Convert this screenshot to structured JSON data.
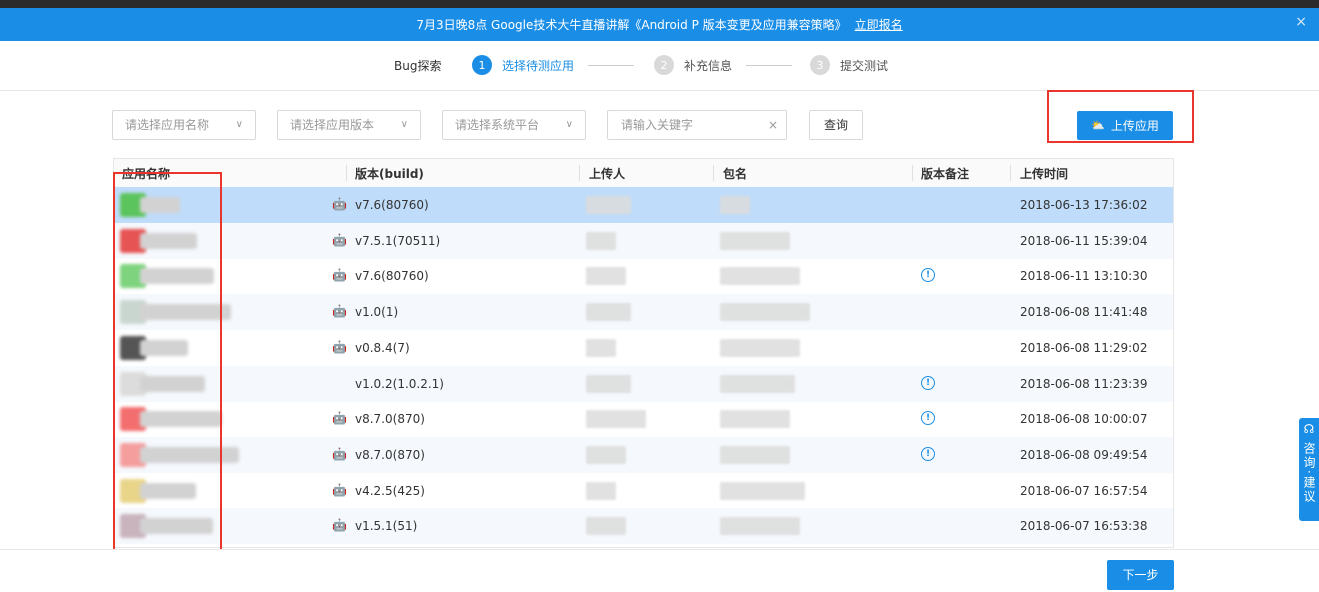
{
  "banner": {
    "text": "7月3日晚8点 Google技术大牛直播讲解《Android P 版本变更及应用兼容策略》",
    "link": "立即报名",
    "close": "×"
  },
  "steps": {
    "prev": "Bug探索",
    "items": [
      {
        "num": "1",
        "label": "选择待测应用",
        "active": true
      },
      {
        "num": "2",
        "label": "补充信息",
        "active": false
      },
      {
        "num": "3",
        "label": "提交测试",
        "active": false
      }
    ]
  },
  "filters": {
    "app_name": "请选择应用名称",
    "app_version": "请选择应用版本",
    "platform": "请选择系统平台",
    "keyword_placeholder": "请输入关键字",
    "clear": "×",
    "query": "查询",
    "chevron": "∨"
  },
  "upload": {
    "label": "上传应用",
    "icon": "upload-cloud-icon"
  },
  "table": {
    "headers": [
      "应用名称",
      "版本(build)",
      "上传人",
      "包名",
      "版本备注",
      "上传时间"
    ],
    "rows": [
      {
        "platform": "android",
        "version": "v7.6(80760)",
        "note": false,
        "time": "2018-06-13 17:36:02",
        "icon_color": "#5cc45c"
      },
      {
        "platform": "android",
        "version": "v7.5.1(70511)",
        "note": false,
        "time": "2018-06-11 15:39:04",
        "icon_color": "#e65454"
      },
      {
        "platform": "android",
        "version": "v7.6(80760)",
        "note": true,
        "time": "2018-06-11 13:10:30",
        "icon_color": "#7ed37e"
      },
      {
        "platform": "android",
        "version": "v1.0(1)",
        "note": false,
        "time": "2018-06-08 11:41:48",
        "icon_color": "#c9d6cf"
      },
      {
        "platform": "android",
        "version": "v0.8.4(7)",
        "note": false,
        "time": "2018-06-08 11:29:02",
        "icon_color": "#555555"
      },
      {
        "platform": "ios",
        "version": "v1.0.2(1.0.2.1)",
        "note": true,
        "time": "2018-06-08 11:23:39",
        "icon_color": "#dcdcdc"
      },
      {
        "platform": "android",
        "version": "v8.7.0(870)",
        "note": true,
        "time": "2018-06-08 10:00:07",
        "icon_color": "#f36f6f"
      },
      {
        "platform": "android",
        "version": "v8.7.0(870)",
        "note": true,
        "time": "2018-06-08 09:49:54",
        "icon_color": "#f59e9e"
      },
      {
        "platform": "android",
        "version": "v4.2.5(425)",
        "note": false,
        "time": "2018-06-07 16:57:54",
        "icon_color": "#e9d58a"
      },
      {
        "platform": "android",
        "version": "v1.5.1(51)",
        "note": false,
        "time": "2018-06-07 16:53:38",
        "icon_color": "#c9b3bd"
      }
    ],
    "note_symbol": "!",
    "android_symbol": "🤖",
    "ios_symbol": ""
  },
  "footer": {
    "next": "下一步"
  },
  "side": {
    "label": "咨询·建议",
    "icon": "headset-icon"
  },
  "colors": {
    "accent": "#1a8ee6",
    "highlight": "#e8362c",
    "selected_row": "#bfdcfa"
  }
}
